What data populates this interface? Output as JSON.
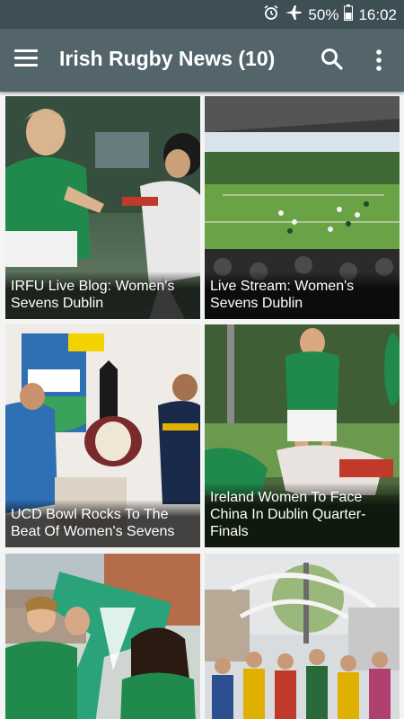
{
  "status_bar": {
    "battery_percent": "50%",
    "time": "16:02",
    "icons": [
      "alarm-icon",
      "airplane-icon",
      "battery-icon"
    ]
  },
  "app_bar": {
    "title": "Irish Rugby News (10)",
    "icons": [
      "menu-icon",
      "search-icon",
      "more-vert-icon"
    ]
  },
  "articles": [
    {
      "title": "IRFU Live Blog: Women's Sevens Dublin"
    },
    {
      "title": "Live Stream: Women's Sevens Dublin"
    },
    {
      "title": "UCD Bowl Rocks To The Beat Of Women's Sevens"
    },
    {
      "title": "Ireland Women To Face China In Dublin Quarter-Finals"
    },
    {
      "title": ""
    },
    {
      "title": ""
    }
  ],
  "colors": {
    "status_bar": "#3e4e55",
    "app_bar": "#53656b",
    "background": "#f4f4f4"
  }
}
